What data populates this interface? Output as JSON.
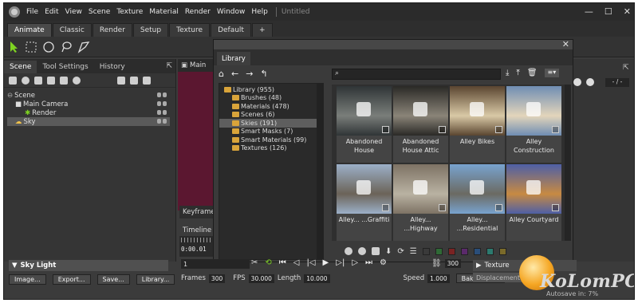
{
  "menubar": {
    "items": [
      "File",
      "Edit",
      "View",
      "Scene",
      "Texture",
      "Material",
      "Render",
      "Window",
      "Help"
    ],
    "doc_title": "Untitled"
  },
  "mode_tabs": [
    "Animate",
    "Classic",
    "Render",
    "Setup",
    "Texture",
    "Default",
    "+"
  ],
  "left_panel": {
    "tabs": [
      "Scene",
      "Tool Settings",
      "History"
    ],
    "tree": [
      "Scene",
      "Main Camera",
      "Render",
      "Sky"
    ]
  },
  "viewport": {
    "tab": "Main"
  },
  "library": {
    "title": "Library",
    "tree": [
      "Library (955)",
      "Brushes (48)",
      "Materials (478)",
      "Scenes (6)",
      "Skies (191)",
      "Smart Masks (7)",
      "Smart Materials (99)",
      "Textures (126)"
    ],
    "tiles": [
      {
        "label": "Abandoned House",
        "color_a": "#2f3436",
        "color_b": "#7a7e7a"
      },
      {
        "label": "Abandoned House Attic",
        "color_a": "#2a2926",
        "color_b": "#8a8478"
      },
      {
        "label": "Alley Bikes",
        "color_a": "#5a4530",
        "color_b": "#d9c9a6"
      },
      {
        "label": "Alley Construction",
        "color_a": "#6f8db3",
        "color_b": "#e3d5bb"
      },
      {
        "label": "Alley... ...Graffiti",
        "color_a": "#9cb0c8",
        "color_b": "#6b6358"
      },
      {
        "label": "Alley... ...Highway",
        "color_a": "#7d7264",
        "color_b": "#b9b2a2"
      },
      {
        "label": "Alley... ...Residential",
        "color_a": "#78a3cf",
        "color_b": "#6b6a62"
      },
      {
        "label": "Alley Courtyard",
        "color_a": "#4e5fa6",
        "color_b": "#c78a42"
      }
    ],
    "swatches": [
      "#3a3a3a",
      "#2f6a36",
      "#7a2323",
      "#5b2a6b",
      "#2a4e7a",
      "#2c7a6f",
      "#7a6a2a"
    ]
  },
  "bottom": {
    "keyframes_tab": "Keyframe",
    "timeline_tab": "Timeline",
    "timecode": "0:00.01",
    "frame_value": "1",
    "frames_label": "Frames",
    "frames_value": "300",
    "fps_label": "FPS",
    "fps_value": "30.000",
    "length_label": "Length",
    "length_value": "10.000",
    "speed_label": "Speed",
    "speed_value": "1.000",
    "bake_speed": "Bake Speed",
    "end_frame": "300",
    "sky_light": "Sky Light",
    "buttons": [
      "Image...",
      "Export...",
      "Save...",
      "Library..."
    ],
    "texture_label": "Texture",
    "displacement_label": "Displacement",
    "autosave": "Autosave in: 7%",
    "zoom_value": "- / -"
  },
  "watermark": "KoLomPC"
}
